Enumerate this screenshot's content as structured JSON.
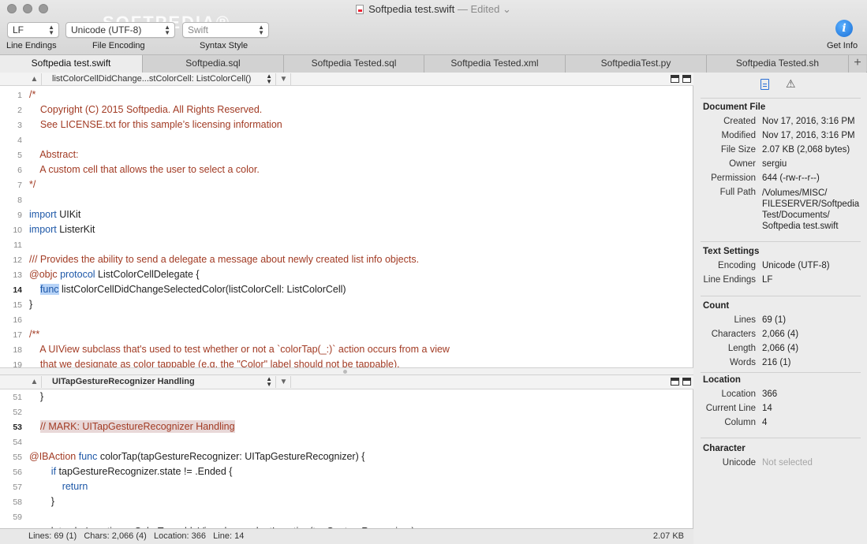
{
  "window": {
    "title": "Softpedia test.swift",
    "edited": "— Edited ⌄",
    "watermark": "SOFTPEDIA®"
  },
  "toolbar": {
    "line_endings": {
      "value": "LF",
      "label": "Line Endings"
    },
    "file_encoding": {
      "value": "Unicode (UTF-8)",
      "label": "File Encoding"
    },
    "syntax_style": {
      "value": "Swift",
      "label": "Syntax Style"
    },
    "get_info": {
      "label": "Get Info",
      "icon": "info-icon"
    }
  },
  "tabs": [
    {
      "label": "Softpedia test.swift",
      "active": true
    },
    {
      "label": "Softpedia.sql"
    },
    {
      "label": "Softpedia Tested.sql"
    },
    {
      "label": "Softpedia Tested.xml"
    },
    {
      "label": "SoftpediaTest.py"
    },
    {
      "label": "Softpedia Tested.sh"
    }
  ],
  "add_tab": "+",
  "top_pane": {
    "function": "listColorCellDidChange...stColorCell: ListColorCell()",
    "lines": [
      {
        "n": "1",
        "text": "/*"
      },
      {
        "n": "2",
        "text": "    Copyright (C) 2015 Softpedia. All Rights Reserved."
      },
      {
        "n": "3",
        "text": "    See LICENSE.txt for this sample’s licensing information"
      },
      {
        "n": "4",
        "text": ""
      },
      {
        "n": "5",
        "text": "    Abstract:"
      },
      {
        "n": "6",
        "text": "    A custom cell that allows the user to select a color."
      },
      {
        "n": "7",
        "text": "*/"
      },
      {
        "n": "8",
        "text": ""
      },
      {
        "n": "9",
        "kw": "import",
        "text": " UIKit"
      },
      {
        "n": "10",
        "kw": "import",
        "text": " ListerKit"
      },
      {
        "n": "11",
        "text": ""
      },
      {
        "n": "12",
        "text": "/// Provides the ability to send a delegate a message about newly created list info objects."
      },
      {
        "n": "13",
        "pre": "@objc ",
        "kw": "protocol",
        "text": " ListColorCellDelegate {"
      },
      {
        "n": "14",
        "sel": "func",
        "text": " listColorCellDidChangeSelectedColor(listColorCell: ListColorCell)"
      },
      {
        "n": "15",
        "text": "}"
      },
      {
        "n": "16",
        "text": ""
      },
      {
        "n": "17",
        "text": "/**"
      },
      {
        "n": "18",
        "text": "    A UIView subclass that's used to test whether or not a `colorTap(_:)` action occurs from a view"
      },
      {
        "n": "19",
        "text": "    that we designate as color tappable (e.g. the \"Color\" label should not be tappable)."
      }
    ]
  },
  "bottom_pane": {
    "function": "UITapGestureRecognizer Handling",
    "lines": [
      {
        "n": "51",
        "text": "    }"
      },
      {
        "n": "52",
        "text": ""
      },
      {
        "n": "53",
        "mark": "// MARK: UITapGestureRecognizer Handling"
      },
      {
        "n": "54",
        "text": ""
      },
      {
        "n": "55",
        "pre": "@IBAction ",
        "kw": "func",
        "text": " colorTap(tapGestureRecognizer: UITapGestureRecognizer) {"
      },
      {
        "n": "56",
        "kw": "if",
        "text": " tapGestureRecognizer.state != .Ended {",
        "indent": 2
      },
      {
        "n": "57",
        "kw": "return",
        "text": "",
        "indent": 3
      },
      {
        "n": "58",
        "text": "        }"
      },
      {
        "n": "59",
        "text": ""
      },
      {
        "n": "60",
        "text": "        let colorLocation = ColorTappableView.descendantLocation(tapGestureRecognizer)"
      }
    ]
  },
  "status": {
    "left": "Lines: 69 (1)   Chars: 2,066 (4)   Location: 366   Line: 14",
    "right": "2.07 KB"
  },
  "inspector": {
    "document_file": {
      "title": "Document File",
      "created": {
        "k": "Created",
        "v": "Nov 17, 2016, 3:16 PM"
      },
      "modified": {
        "k": "Modified",
        "v": "Nov 17, 2016, 3:16 PM"
      },
      "size": {
        "k": "File Size",
        "v": "2.07 KB (2,068 bytes)"
      },
      "owner": {
        "k": "Owner",
        "v": "sergiu"
      },
      "permission": {
        "k": "Permission",
        "v": "644 (-rw-r--r--)"
      },
      "path": {
        "k": "Full Path",
        "v": "/Volumes/MISC/\nFILESERVER/Softpedia\nTest/Documents/\nSoftpedia test.swift"
      }
    },
    "text_settings": {
      "title": "Text Settings",
      "encoding": {
        "k": "Encoding",
        "v": "Unicode (UTF-8)"
      },
      "line_endings": {
        "k": "Line Endings",
        "v": "LF"
      }
    },
    "count": {
      "title": "Count",
      "lines": {
        "k": "Lines",
        "v": "69 (1)"
      },
      "characters": {
        "k": "Characters",
        "v": "2,066 (4)"
      },
      "length": {
        "k": "Length",
        "v": "2,066 (4)"
      },
      "words": {
        "k": "Words",
        "v": "216 (1)"
      }
    },
    "location": {
      "title": "Location",
      "location": {
        "k": "Location",
        "v": "366"
      },
      "current_line": {
        "k": "Current Line",
        "v": "14"
      },
      "column": {
        "k": "Column",
        "v": "4"
      }
    },
    "character": {
      "title": "Character",
      "unicode": {
        "k": "Unicode",
        "v": "Not selected"
      }
    }
  }
}
